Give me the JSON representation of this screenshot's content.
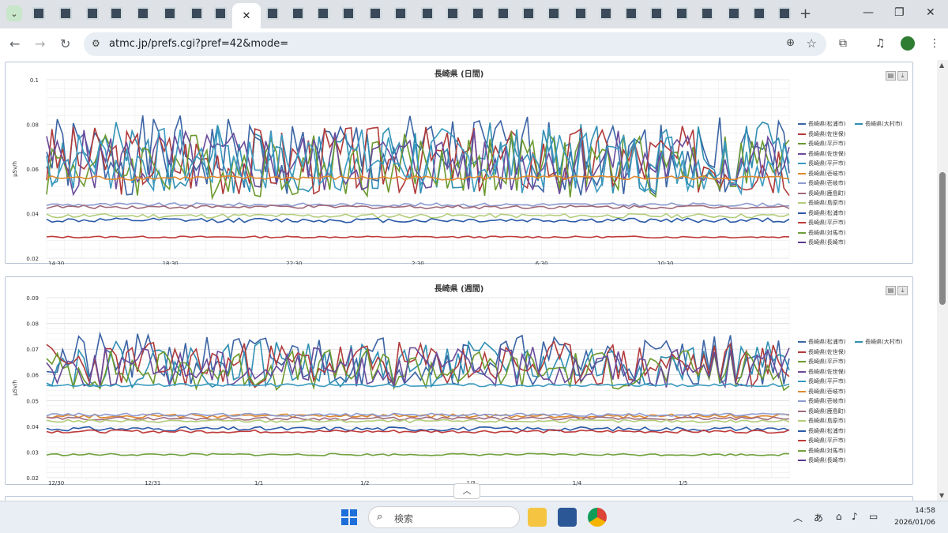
{
  "browser": {
    "url": "atmc.jp/prefs.cgi?pref=42&mode=",
    "tab_active_glyph": "✕",
    "new_tab": "+"
  },
  "taskbar": {
    "search_placeholder": "検索",
    "ime": "あ",
    "time": "14:58",
    "date": "2026/01/06"
  },
  "chart_data": [
    {
      "type": "line",
      "title": "長崎県 (日間)",
      "ylabel": "μSv/h",
      "ylim": [
        0.02,
        0.1
      ],
      "yticks": [
        "0.1",
        "0.08",
        "0.06",
        "0.04",
        "0.02"
      ],
      "xticks": [
        "14:30",
        "18:30",
        "22:30",
        "2:30",
        "6:30",
        "10:30"
      ],
      "legend": [
        "長崎県(松浦市)",
        "長崎県(大村市)",
        "長崎県(佐世保)",
        "長崎県(平戸市)",
        "長崎県(佐世保)",
        "長崎県(平戸市)",
        "長崎県(壱岐市)",
        "長崎県(壱岐市)",
        "長崎県(鹿島町)",
        "長崎県(島原市)",
        "長崎県(松浦市)",
        "長崎県(平戸市)",
        "長崎県(対馬市)",
        "長崎県(長崎市)"
      ],
      "colors": [
        "#3b64a4",
        "#2f8fb3",
        "#b03a3a",
        "#6b9a2e",
        "#6a4b9a",
        "#3a9ac0",
        "#e08a2e",
        "#8c9ad0",
        "#a06a7a",
        "#b3cc7a",
        "#2a5aa8",
        "#c03a3a",
        "#6ea03a",
        "#5a3a90"
      ],
      "series": [
        {
          "name": "長崎県(松浦市)",
          "level": 0.066,
          "amp": 0.018,
          "seed": 1
        },
        {
          "name": "長崎県(大村市)",
          "level": 0.065,
          "amp": 0.016,
          "seed": 2
        },
        {
          "name": "長崎県(佐世保)",
          "level": 0.064,
          "amp": 0.016,
          "seed": 3
        },
        {
          "name": "長崎県(平戸市)",
          "level": 0.062,
          "amp": 0.015,
          "seed": 4
        },
        {
          "name": "長崎県(佐世保)",
          "level": 0.063,
          "amp": 0.015,
          "seed": 5
        },
        {
          "name": "長崎県(壱岐市)",
          "level": 0.064,
          "amp": 0.015,
          "seed": 7
        },
        {
          "name": "長崎県(壱岐市)",
          "level": 0.056,
          "amp": 0.001,
          "seed": 8
        },
        {
          "name": "長崎県(松浦市)",
          "level": 0.044,
          "amp": 0.0008,
          "seed": 9
        },
        {
          "name": "長崎県(平戸市)",
          "level": 0.043,
          "amp": 0.0008,
          "seed": 10
        },
        {
          "name": "長崎県(対馬市)",
          "level": 0.039,
          "amp": 0.001,
          "seed": 11
        },
        {
          "name": "長崎県(長崎市)",
          "level": 0.037,
          "amp": 0.001,
          "seed": 12
        },
        {
          "name": "長崎県(平戸市)",
          "level": 0.0295,
          "amp": 0.0004,
          "seed": 13
        }
      ]
    },
    {
      "type": "line",
      "title": "長崎県 (週間)",
      "ylabel": "μSv/h",
      "ylim": [
        0.02,
        0.09
      ],
      "yticks": [
        "0.09",
        "0.08",
        "0.07",
        "0.06",
        "0.05",
        "0.04",
        "0.03",
        "0.02"
      ],
      "xticks": [
        "12/30",
        "12/31",
        "1/1",
        "1/2",
        "1/3",
        "1/4",
        "1/5"
      ],
      "legend": [
        "長崎県(松浦市)",
        "長崎県(大村市)",
        "長崎県(佐世保)",
        "長崎県(平戸市)",
        "長崎県(佐世保)",
        "長崎県(平戸市)",
        "長崎県(壱岐市)",
        "長崎県(壱岐市)",
        "長崎県(鹿島町)",
        "長崎県(島原市)",
        "長崎県(松浦市)",
        "長崎県(平戸市)",
        "長崎県(対馬市)",
        "長崎県(長崎市)"
      ],
      "colors": [
        "#3b64a4",
        "#2f8fb3",
        "#b03a3a",
        "#6b9a2e",
        "#6a4b9a",
        "#3a9ac0",
        "#e08a2e",
        "#8c9ad0",
        "#a06a7a",
        "#b3cc7a",
        "#2a5aa8",
        "#c03a3a",
        "#6ea03a",
        "#5a3a90"
      ],
      "series": [
        {
          "name": "長崎県(松浦市)",
          "level": 0.066,
          "amp": 0.01,
          "seed": 21
        },
        {
          "name": "長崎県(大村市)",
          "level": 0.064,
          "amp": 0.009,
          "seed": 22
        },
        {
          "name": "長崎県(佐世保)",
          "level": 0.064,
          "amp": 0.009,
          "seed": 23
        },
        {
          "name": "長崎県(平戸市)",
          "level": 0.062,
          "amp": 0.008,
          "seed": 24
        },
        {
          "name": "長崎県(壱岐市)",
          "level": 0.063,
          "amp": 0.008,
          "seed": 25
        },
        {
          "name": "長崎県(壱岐市)",
          "level": 0.056,
          "amp": 0.0006,
          "seed": 26
        },
        {
          "name": "長崎県(鹿島町)",
          "level": 0.044,
          "amp": 0.0008,
          "seed": 27
        },
        {
          "name": "長崎県(島原市)",
          "level": 0.0445,
          "amp": 0.0006,
          "seed": 28
        },
        {
          "name": "長崎県(松浦市)",
          "level": 0.043,
          "amp": 0.0006,
          "seed": 29
        },
        {
          "name": "長崎県(平戸市)",
          "level": 0.042,
          "amp": 0.0006,
          "seed": 30
        },
        {
          "name": "長崎県(対馬市)",
          "level": 0.039,
          "amp": 0.0008,
          "seed": 31
        },
        {
          "name": "長崎県(長崎市)",
          "level": 0.038,
          "amp": 0.0006,
          "seed": 32
        },
        {
          "name": "長崎県(平戸市)",
          "level": 0.029,
          "amp": 0.0004,
          "seed": 33
        }
      ]
    }
  ]
}
